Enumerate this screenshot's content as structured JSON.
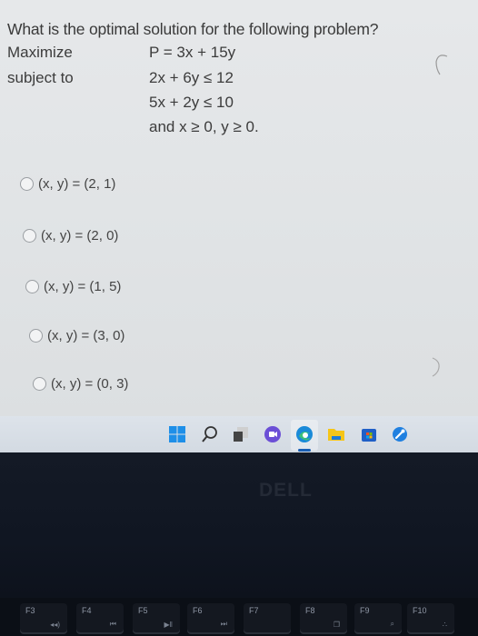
{
  "question": {
    "title": "What is the optimal solution for the following problem?",
    "objective_label": "Maximize",
    "objective": "P = 3x + 15y",
    "constraints_label": "subject to",
    "constraints": [
      "2x + 6y ≤ 12",
      "5x + 2y ≤ 10",
      "and x ≥ 0, y ≥ 0."
    ]
  },
  "options": [
    {
      "label": "(x, y) = (2, 1)",
      "selected": false
    },
    {
      "label": "(x, y) = (2, 0)",
      "selected": false
    },
    {
      "label": "(x, y) = (1, 5)",
      "selected": false
    },
    {
      "label": "(x, y) = (3, 0)",
      "selected": false
    },
    {
      "label": "(x, y) = (0, 3)",
      "selected": false
    }
  ],
  "taskbar": {
    "icons": [
      "start-icon",
      "search-icon",
      "task-view-icon",
      "chat-icon",
      "edge-icon",
      "file-explorer-icon",
      "store-icon",
      "settings-icon"
    ],
    "active": "edge-icon"
  },
  "bezel": {
    "brand": "DELL"
  },
  "keyboard": {
    "keys": [
      {
        "label": "F3",
        "icon": "◂◂)"
      },
      {
        "label": "F4",
        "icon": "⏮"
      },
      {
        "label": "F5",
        "icon": "▶‖"
      },
      {
        "label": "F6",
        "icon": "⏭"
      },
      {
        "label": "F7",
        "icon": ""
      },
      {
        "label": "F8",
        "icon": "❐"
      },
      {
        "label": "F9",
        "icon": "⌕"
      },
      {
        "label": "F10",
        "icon": "∴"
      }
    ]
  }
}
